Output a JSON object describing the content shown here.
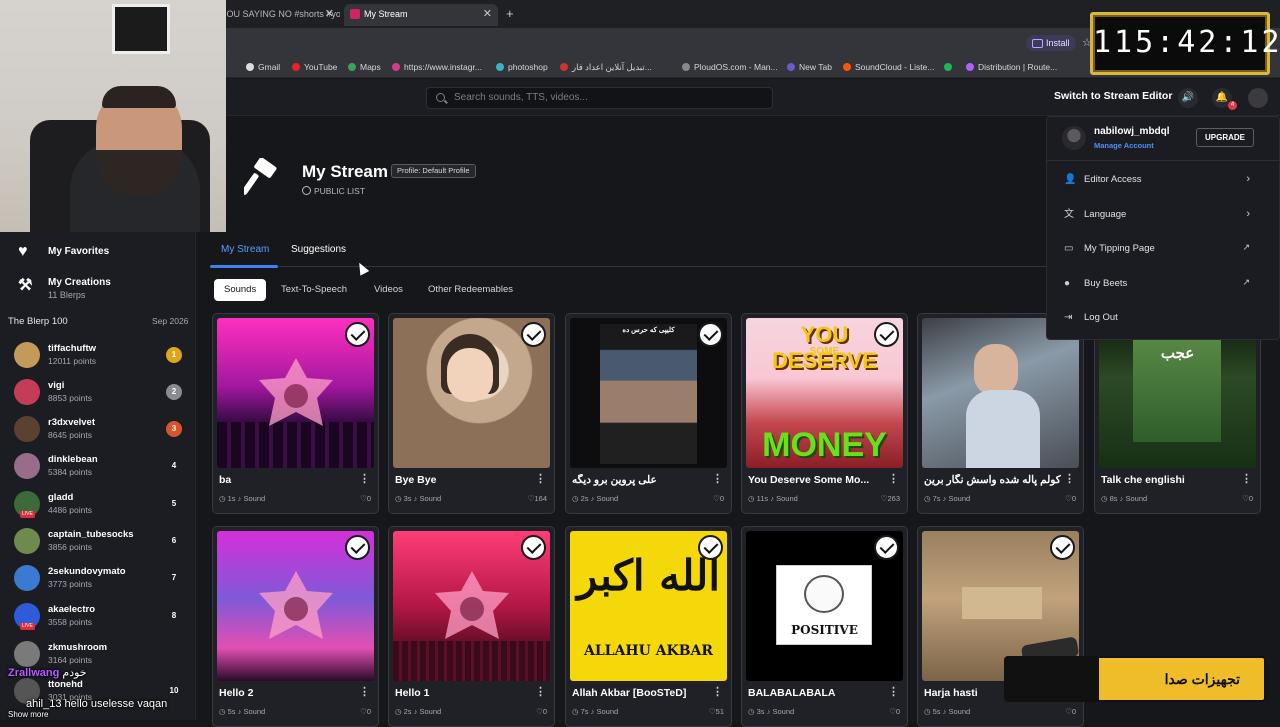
{
  "browser": {
    "tabs": [
      {
        "title": "DOU SAYING NO #shorts #yout"
      },
      {
        "title": "My Stream"
      }
    ],
    "install_label": "Install",
    "bookmarks": [
      "Gmail",
      "YouTube",
      "Maps",
      "https://www.instagr...",
      "photoshop",
      "تبدیل آنلاین اعداد فار...",
      "PloudOS.com - Man...",
      "New Tab",
      "SoundCloud - Liste...",
      "Distribution | Route..."
    ]
  },
  "header": {
    "search_placeholder": "Search sounds, TTS, videos...",
    "switch_label": "Switch to Stream Editor",
    "notification_count": "4"
  },
  "sidebar": {
    "favorites_label": "My Favorites",
    "creations_label": "My Creations",
    "creations_sub": "11 Blerps",
    "board_title": "The Blerp 100",
    "board_date": "Sep 2026",
    "ranks": [
      {
        "name": "tiffachuftw",
        "points": "12011 points",
        "pos": "1",
        "color": "#e0a61a",
        "avatar": "#c39a5a"
      },
      {
        "name": "vigi",
        "points": "8853 points",
        "pos": "2",
        "color": "#8a8b90",
        "avatar": "#c63c58"
      },
      {
        "name": "r3dxvelvet",
        "points": "8645 points",
        "pos": "3",
        "color": "#d9542b",
        "avatar": "#5a4130"
      },
      {
        "name": "dinklebean",
        "points": "5384 points",
        "pos": "4",
        "color": "",
        "avatar": "#9a6c8c"
      },
      {
        "name": "gladd",
        "points": "4486 points",
        "pos": "5",
        "color": "",
        "avatar": "#3d6a3a"
      },
      {
        "name": "captain_tubesocks",
        "points": "3856 points",
        "pos": "6",
        "color": "",
        "avatar": "#6f8a4f"
      },
      {
        "name": "2sekundovymato",
        "points": "3773 points",
        "pos": "7",
        "color": "",
        "avatar": "#3a7ad0"
      },
      {
        "name": "akaelectro",
        "points": "3558 points",
        "pos": "8",
        "color": "",
        "avatar": "#2e5bd8"
      },
      {
        "name": "zkmushroom",
        "points": "3164 points",
        "pos": "",
        "color": "",
        "avatar": "#7a7a7a"
      },
      {
        "name": "ttonehd",
        "points": "3031 points",
        "pos": "10",
        "color": "",
        "avatar": "#555"
      }
    ]
  },
  "page": {
    "title": "My Stream",
    "profile_tag": "Profile: Default Profile",
    "visibility": "PUBLIC LIST",
    "tabs": [
      "My Stream",
      "Suggestions"
    ],
    "subtabs": [
      "Sounds",
      "Text-To-Speech",
      "Videos",
      "Other Redeemables"
    ],
    "sounds": [
      {
        "title": "ba",
        "duration": "1s",
        "type": "Sound",
        "likes": "0"
      },
      {
        "title": "Bye Bye",
        "duration": "3s",
        "type": "Sound",
        "likes": "164"
      },
      {
        "title": "علی پروین برو دیگه",
        "duration": "2s",
        "type": "Sound",
        "likes": "0"
      },
      {
        "title": "You Deserve Some Mo...",
        "duration": "11s",
        "type": "Sound",
        "likes": "263"
      },
      {
        "title": "کولم پاله شده واسش نگار برین",
        "duration": "7s",
        "type": "Sound",
        "likes": "0"
      },
      {
        "title": "Talk che englishi",
        "duration": "8s",
        "type": "Sound",
        "likes": "0"
      },
      {
        "title": "Hello 2",
        "duration": "5s",
        "type": "Sound",
        "likes": "0"
      },
      {
        "title": "Hello 1",
        "duration": "2s",
        "type": "Sound",
        "likes": "0"
      },
      {
        "title": "Allah Akbar [BooSTeD]",
        "duration": "7s",
        "type": "Sound",
        "likes": "51"
      },
      {
        "title": "BALABALABALA",
        "duration": "3s",
        "type": "Sound",
        "likes": "0"
      },
      {
        "title": "Harja hasti",
        "duration": "5s",
        "type": "Sound",
        "likes": "0"
      }
    ],
    "thumb_texts": {
      "deserve_top": "YOU DESERVE",
      "deserve_some": "SOME",
      "deserve_money": "MONEY",
      "talk_text": "عجب",
      "allahu_arabic": "الله اكبر",
      "allahu_latin": "ALLAHU AKBAR",
      "be_positive": "POSITIVE",
      "news_caption": "کلیپی که حرس ده"
    }
  },
  "account_menu": {
    "username": "nabilowj_mbdql",
    "manage": "Manage Account",
    "upgrade": "UPGRADE",
    "items": [
      "Editor Access",
      "Language",
      "My Tipping Page",
      "Buy Beets",
      "Log Out"
    ]
  },
  "overlay": {
    "clock": "115:42:12",
    "banner": "تجهیزات صدا",
    "chat": [
      {
        "user": "Zrallwang",
        "text": "خودم",
        "color": "#b45cff"
      },
      {
        "user": "ahil_13",
        "text": "hello uselesse vaqan",
        "color": "#fff"
      },
      {
        "user": "",
        "text": "Show more",
        "color": "#ccc"
      }
    ]
  }
}
